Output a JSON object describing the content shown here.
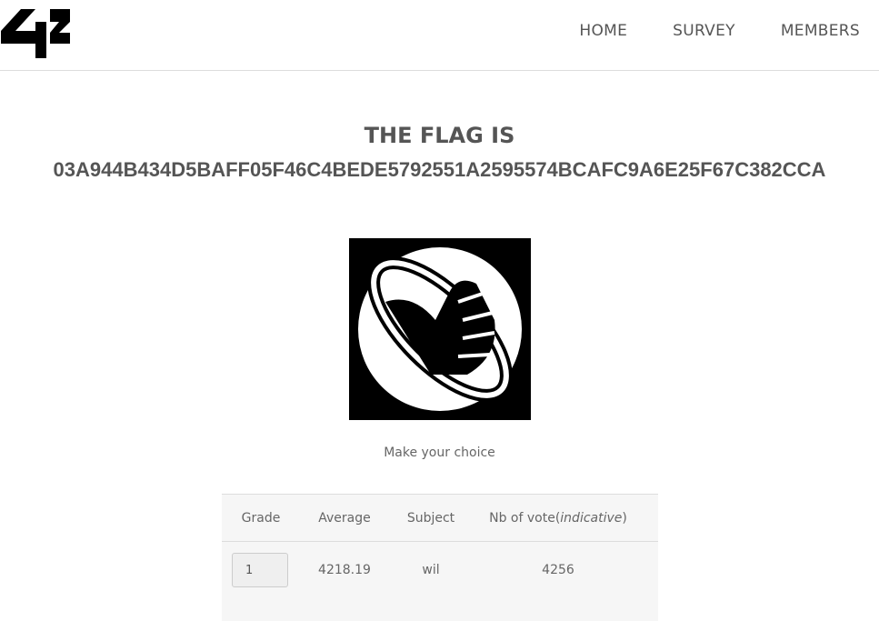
{
  "nav": {
    "logo": "42",
    "items": [
      {
        "label": "HOME"
      },
      {
        "label": "SURVEY"
      },
      {
        "label": "MEMBERS"
      }
    ]
  },
  "flag": {
    "title": "THE FLAG IS",
    "value": "03A944B434D5BAFF05F46C4BEDE5792551A2595574BCAFC9A6E25F67C382CCA"
  },
  "choice_text": "Make your choice",
  "table": {
    "headers": {
      "grade": "Grade",
      "average": "Average",
      "subject": "Subject",
      "votes": "Nb of vote(",
      "votes_italic": "indicative",
      "votes_end": ")"
    },
    "rows": [
      {
        "grade": "1",
        "average": "4218.19",
        "subject": "wil",
        "votes": "4256"
      }
    ]
  }
}
